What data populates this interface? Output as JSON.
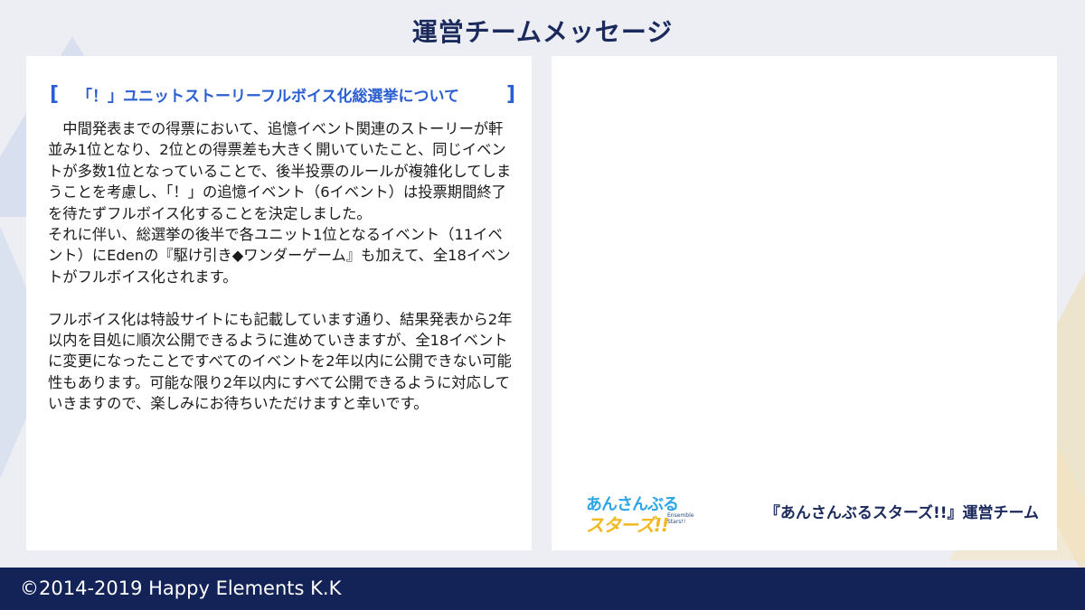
{
  "title": "運営チームメッセージ",
  "notice": {
    "heading_open": "[",
    "heading_text": "「！」ユニットストーリーフルボイス化総選挙について",
    "heading_close": "]",
    "paragraphs": [
      "中間発表までの得票において、追憶イベント関連のストーリーが軒並み1位となり、2位との得票差も大きく開いていたこと、同じイベントが多数1位となっていることで、後半投票のルールが複雑化してしまうことを考慮し、「！」の追憶イベント（6イベント）は投票期間終了を待たずフルボイス化することを決定しました。",
      "それに伴い、総選挙の後半で各ユニット1位となるイベント（11イベント）にEdenの『駆け引き◆ワンダーゲーム』も加えて、全18イベントがフルボイス化されます。",
      "フルボイス化は特設サイトにも記載しています通り、結果発表から2年以内を目処に順次公開できるように進めていきますが、全18イベントに変更になったことですべてのイベントを2年以内に公開できない可能性もあります。可能な限り2年以内にすべて公開できるように対応していきますので、楽しみにお待ちいただけますと幸いです。"
    ]
  },
  "logo": {
    "line1": "あんさんぶる",
    "line2": "スターズ!!",
    "sub": "Ensemble Stars!!"
  },
  "signature": "『あんさんぶるスターズ!!』運営チーム",
  "footer": {
    "copyright": "©2014-2019 Happy Elements K.K"
  },
  "colors": {
    "title": "#1b2a5c",
    "heading": "#2a5fd1",
    "footer_bg": "#132257",
    "logo_blue": "#2ea6e6",
    "logo_yellow": "#f0b91f"
  }
}
